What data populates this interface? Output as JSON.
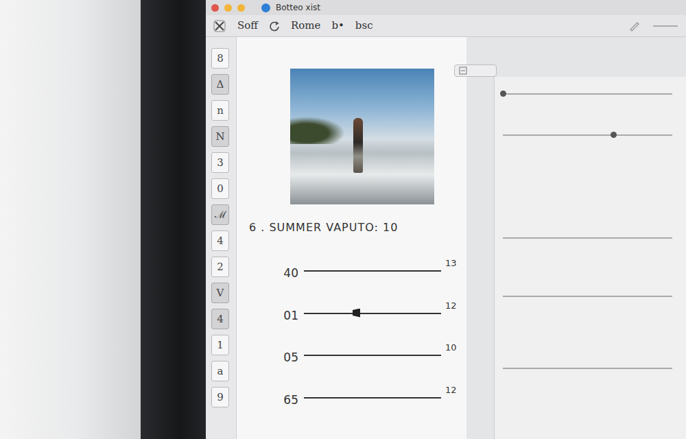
{
  "window": {
    "title": "Botteo xist"
  },
  "toolbar": {
    "items": [
      "Soff",
      "Rome",
      "b•",
      "bsc"
    ]
  },
  "sidebar": {
    "items": [
      {
        "label": "8",
        "selected": false
      },
      {
        "label": "Δ",
        "selected": true
      },
      {
        "label": "n",
        "selected": false
      },
      {
        "label": "Ν",
        "selected": true
      },
      {
        "label": "3",
        "selected": false
      },
      {
        "label": "0",
        "selected": false
      },
      {
        "label": "ℳ",
        "selected": true
      },
      {
        "label": "4",
        "selected": false
      },
      {
        "label": "2",
        "selected": false
      },
      {
        "label": "V",
        "selected": true
      },
      {
        "label": "4",
        "selected": true
      },
      {
        "label": "1",
        "selected": false
      },
      {
        "label": "a",
        "selected": false
      },
      {
        "label": "9",
        "selected": false
      }
    ]
  },
  "photo": {
    "caption": "6 . SUMMER VAPUTO: 10"
  },
  "sliders": [
    {
      "kind": "line",
      "left": "40",
      "right": "13"
    },
    {
      "kind": "slider",
      "left": "01",
      "right": "12",
      "level": 0.38
    },
    {
      "kind": "line",
      "left": "05",
      "right": "10"
    },
    {
      "kind": "line",
      "left": "65",
      "right": "12"
    }
  ],
  "right_panel": {
    "tracks": [
      {
        "kind": "slider",
        "level": 0.0
      },
      {
        "kind": "slider",
        "level": 0.65
      },
      {
        "kind": "line"
      },
      {
        "kind": "line"
      },
      {
        "kind": "line"
      }
    ]
  }
}
